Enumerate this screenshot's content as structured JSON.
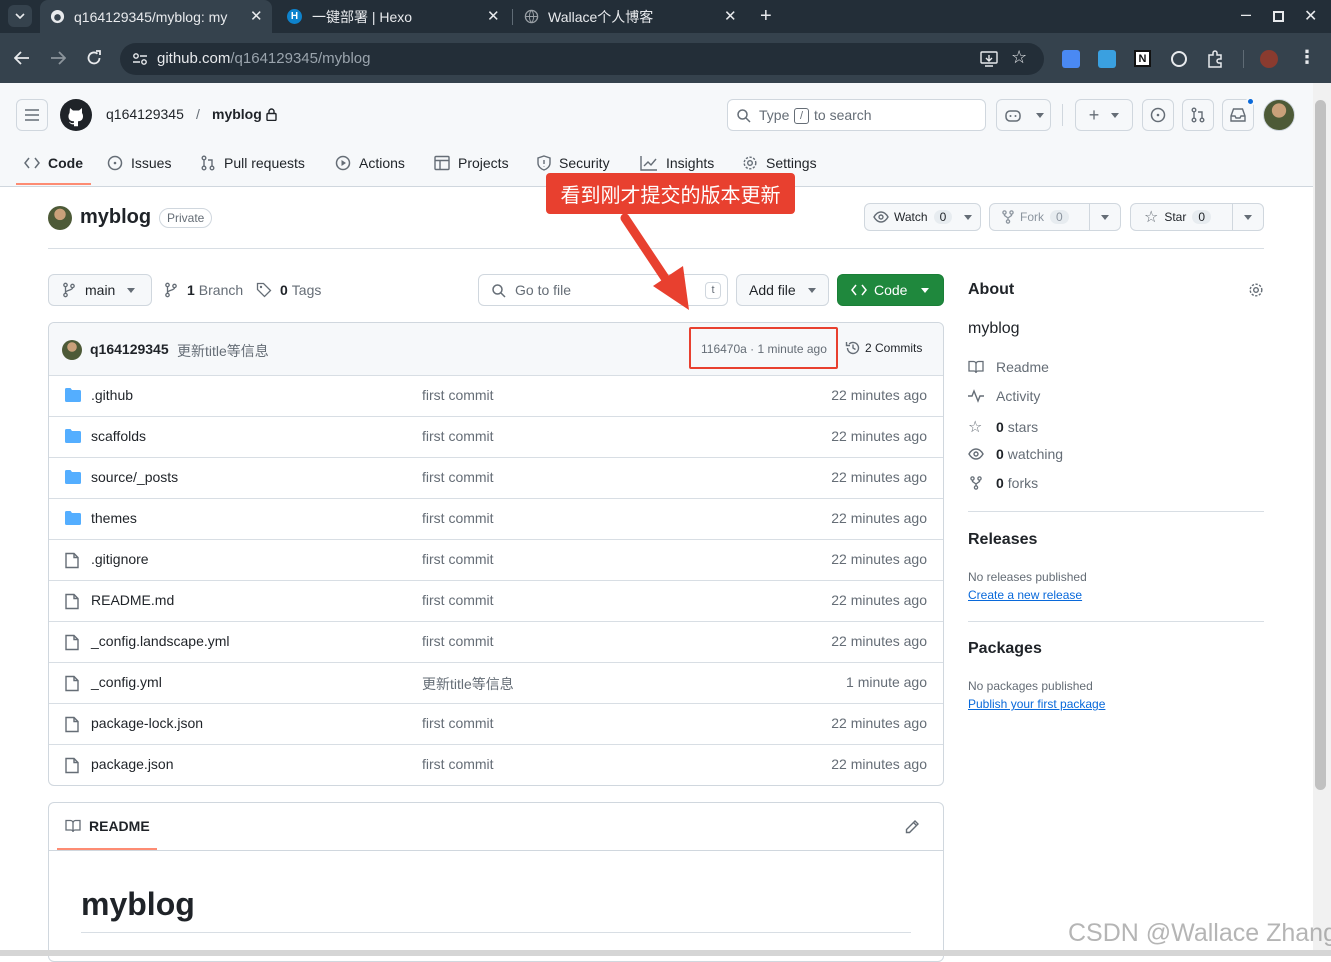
{
  "browser": {
    "tabs": [
      {
        "title": "q164129345/myblog: my",
        "icon": "github-icon"
      },
      {
        "title": "一键部署 | Hexo",
        "icon": "hexo-icon"
      },
      {
        "title": "Wallace个人博客",
        "icon": "globe-icon"
      }
    ],
    "url_host": "github.com",
    "url_path": "/q164129345/myblog"
  },
  "header": {
    "owner": "q164129345",
    "separator": "/",
    "repo": "myblog",
    "search_prefix": "Type",
    "search_key": "/",
    "search_suffix": "to search"
  },
  "nav": {
    "code": "Code",
    "issues": "Issues",
    "pulls": "Pull requests",
    "actions": "Actions",
    "projects": "Projects",
    "security": "Security",
    "insights": "Insights",
    "settings": "Settings"
  },
  "annotation": {
    "text": "看到刚才提交的版本更新",
    "color": "#e8402f"
  },
  "repo": {
    "name": "myblog",
    "visibility": "Private",
    "watch_label": "Watch",
    "watch_count": "0",
    "fork_label": "Fork",
    "fork_count": "0",
    "star_label": "Star",
    "star_count": "0"
  },
  "toolbar": {
    "branch": "main",
    "branches_count": "1",
    "branches_label": "Branch",
    "tags_count": "0",
    "tags_label": "Tags",
    "goto_placeholder": "Go to file",
    "goto_key": "t",
    "add_file": "Add file",
    "code": "Code"
  },
  "commit": {
    "author": "q164129345",
    "message": "更新title等信息",
    "hash_time": "116470a · 1 minute ago",
    "commits": "2 Commits"
  },
  "files": [
    {
      "name": ".github",
      "type": "folder",
      "message": "first commit",
      "time": "22 minutes ago"
    },
    {
      "name": "scaffolds",
      "type": "folder",
      "message": "first commit",
      "time": "22 minutes ago"
    },
    {
      "name": "source/_posts",
      "type": "folder",
      "message": "first commit",
      "time": "22 minutes ago"
    },
    {
      "name": "themes",
      "type": "folder",
      "message": "first commit",
      "time": "22 minutes ago"
    },
    {
      "name": ".gitignore",
      "type": "file",
      "message": "first commit",
      "time": "22 minutes ago"
    },
    {
      "name": "README.md",
      "type": "file",
      "message": "first commit",
      "time": "22 minutes ago"
    },
    {
      "name": "_config.landscape.yml",
      "type": "file",
      "message": "first commit",
      "time": "22 minutes ago"
    },
    {
      "name": "_config.yml",
      "type": "file",
      "message": "更新title等信息",
      "time": "1 minute ago"
    },
    {
      "name": "package-lock.json",
      "type": "file",
      "message": "first commit",
      "time": "22 minutes ago"
    },
    {
      "name": "package.json",
      "type": "file",
      "message": "first commit",
      "time": "22 minutes ago"
    }
  ],
  "readme": {
    "tab": "README",
    "heading": "myblog"
  },
  "about": {
    "title": "About",
    "description": "myblog",
    "readme": "Readme",
    "activity": "Activity",
    "stars_count": "0",
    "stars_label": "stars",
    "watching_count": "0",
    "watching_label": "watching",
    "forks_count": "0",
    "forks_label": "forks"
  },
  "releases": {
    "title": "Releases",
    "empty": "No releases published",
    "link": "Create a new release"
  },
  "packages": {
    "title": "Packages",
    "empty": "No packages published",
    "link": "Publish your first package"
  },
  "watermark": "CSDN @Wallace Zhang"
}
